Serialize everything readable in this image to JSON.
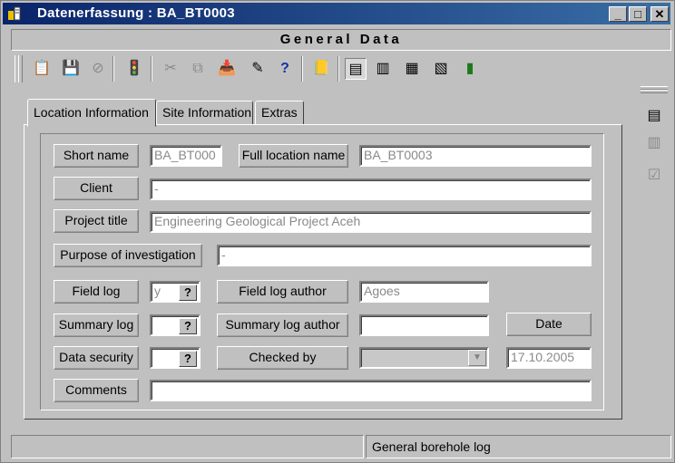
{
  "window": {
    "title": "Datenerfassung  :  BA_BT0003",
    "controls": {
      "minimize": "_",
      "maximize": "□",
      "close": "✕"
    }
  },
  "banner": "General Data",
  "toolbar": {
    "items": [
      {
        "icon": "new-record-icon",
        "glyph": "📋",
        "enabled": true
      },
      {
        "icon": "save-icon",
        "glyph": "💾",
        "enabled": false
      },
      {
        "icon": "cancel-icon",
        "glyph": "⊘",
        "enabled": false
      },
      {
        "icon": "traffic-light-icon",
        "glyph": "🚦",
        "enabled": true
      },
      {
        "icon": "cut-icon",
        "glyph": "✂",
        "enabled": false
      },
      {
        "icon": "copy-icon",
        "glyph": "⧉",
        "enabled": false
      },
      {
        "icon": "paste-icon",
        "glyph": "📥",
        "enabled": false
      },
      {
        "icon": "edit-icon",
        "glyph": "✎",
        "enabled": true
      },
      {
        "icon": "help-icon",
        "glyph": "?",
        "enabled": true
      },
      {
        "icon": "notes-icon",
        "glyph": "📒",
        "enabled": true
      },
      {
        "icon": "view-general-icon",
        "glyph": "▤",
        "enabled": true
      },
      {
        "icon": "view-layers-icon",
        "glyph": "▥",
        "enabled": true
      },
      {
        "icon": "view-samples-icon",
        "glyph": "▦",
        "enabled": true
      },
      {
        "icon": "view-tests-icon",
        "glyph": "▧",
        "enabled": true
      },
      {
        "icon": "view-chart-icon",
        "glyph": "▮",
        "enabled": true
      }
    ]
  },
  "tabs": [
    {
      "label": "Location Information",
      "active": true
    },
    {
      "label": "Site Information",
      "active": false
    },
    {
      "label": "Extras",
      "active": false
    }
  ],
  "form": {
    "short_name": {
      "label": "Short name",
      "value": "BA_BT000"
    },
    "full_location_name": {
      "label": "Full location name",
      "value": "BA_BT0003"
    },
    "client": {
      "label": "Client",
      "value": "-"
    },
    "project_title": {
      "label": "Project title",
      "value": "Engineering Geological Project Aceh"
    },
    "purpose": {
      "label": "Purpose of investigation",
      "value": "-"
    },
    "field_log": {
      "label": "Field log",
      "value": "y",
      "help": "?"
    },
    "field_log_author": {
      "label": "Field log author",
      "value": "Agoes"
    },
    "summary_log": {
      "label": "Summary log",
      "value": "",
      "help": "?"
    },
    "summary_log_author": {
      "label": "Summary log author",
      "value": ""
    },
    "date": {
      "label": "Date",
      "value": "17.10.2005"
    },
    "data_security": {
      "label": "Data security",
      "value": "",
      "help": "?"
    },
    "checked_by": {
      "label": "Checked by",
      "value": "",
      "arrow": "▼"
    },
    "comments": {
      "label": "Comments",
      "value": ""
    }
  },
  "sidebar": {
    "items": [
      {
        "icon": "form-view-icon",
        "glyph": "▤",
        "enabled": true
      },
      {
        "icon": "list-view-icon",
        "glyph": "▥",
        "enabled": false
      },
      {
        "icon": "checklist-icon",
        "glyph": "☑",
        "enabled": false
      }
    ]
  },
  "status": {
    "left": "",
    "right": "General borehole log"
  }
}
